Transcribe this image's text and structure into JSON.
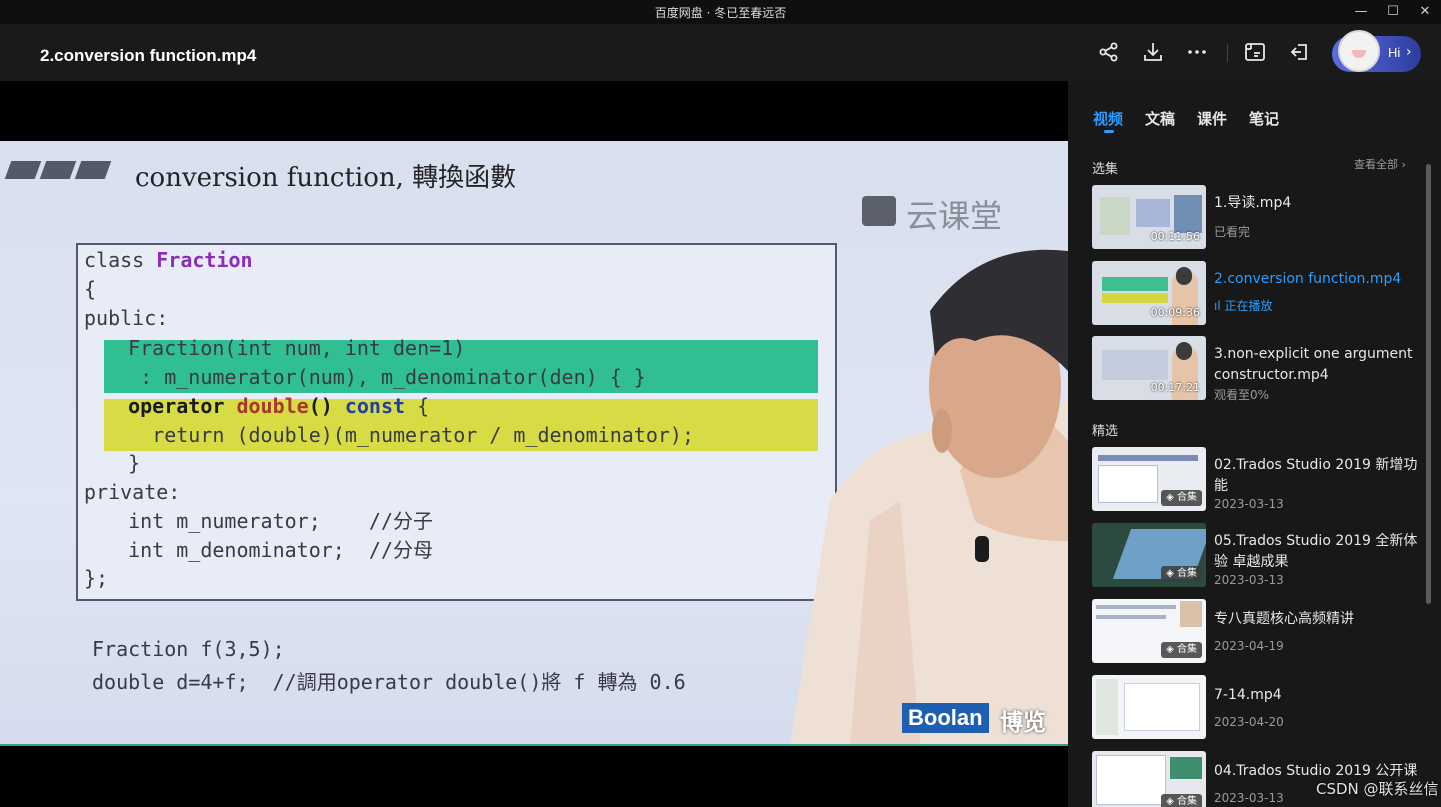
{
  "window": {
    "title": "百度网盘 · 冬已至春远否",
    "controls": [
      "minimize-icon",
      "maximize-icon",
      "close-icon"
    ]
  },
  "header": {
    "file_title": "2.conversion function.mp4",
    "actions": [
      "share-icon",
      "download-icon",
      "more-icon",
      "screenshot-icon",
      "pip-icon"
    ],
    "avatar_label": "Hi"
  },
  "slide": {
    "title": "conversion function, 轉換函數",
    "watermark": "云课堂",
    "code_lines": {
      "l1a": "class ",
      "l1b": "Fraction",
      "l2": "{",
      "l3": "public:",
      "l4": "  Fraction(int num, int den=1)",
      "l5": "   : m_numerator(num), m_denominator(den) { }",
      "l6a": "  operator ",
      "l6b": "double",
      "l6c": "() ",
      "l6d": "const",
      "l6e": " {",
      "l7": "    return (double)(m_numerator / m_denominator);",
      "l8": "  }",
      "l9": "private:",
      "l10": "  int m_numerator;    //分子",
      "l11": "  int m_denominator;  //分母",
      "l12": "};"
    },
    "lower_lines": [
      "Fraction f(3,5);",
      "double d=4+f;  //調用operator double()將 f 轉為 0.6"
    ],
    "logo_en": "Boolan",
    "logo_cn": "博览"
  },
  "sidebar": {
    "tabs": [
      {
        "label": "视频",
        "active": true
      },
      {
        "label": "文稿",
        "active": false
      },
      {
        "label": "课件",
        "active": false
      },
      {
        "label": "笔记",
        "active": false
      }
    ],
    "episodes_header": "选集",
    "view_all": "查看全部",
    "episodes": [
      {
        "title": "1.导读.mp4",
        "sub": "已看完",
        "duration": "00:11:56",
        "playing": false
      },
      {
        "title": "2.conversion function.mp4",
        "sub": "正在播放",
        "duration": "00:09:36",
        "playing": true
      },
      {
        "title": "3.non-explicit one argument constructor.mp4",
        "sub": "观看至0%",
        "duration": "00:17:21",
        "playing": false
      }
    ],
    "featured_header": "精选",
    "featured": [
      {
        "title": "02.Trados Studio 2019 新增功能",
        "date": "2023-03-13",
        "badge": "合集"
      },
      {
        "title": "05.Trados Studio 2019 全新体验 卓越成果",
        "date": "2023-03-13",
        "badge": "合集"
      },
      {
        "title": "专八真题核心高频精讲",
        "date": "2023-04-19",
        "badge": "合集"
      },
      {
        "title": "7-14.mp4",
        "date": "2023-04-20",
        "badge": ""
      },
      {
        "title": "04.Trados Studio 2019 公开课",
        "date": "2023-03-13",
        "badge": "合集"
      }
    ]
  },
  "overlay": {
    "watermark": "CSDN @联系丝信"
  }
}
